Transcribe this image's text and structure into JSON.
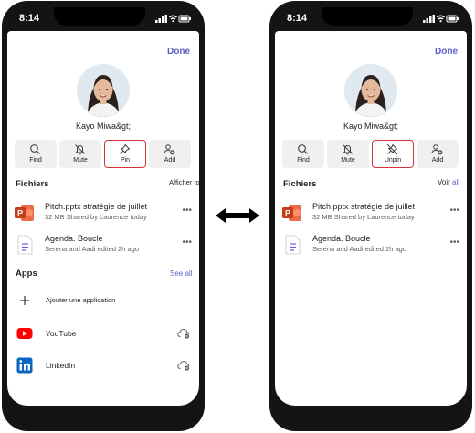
{
  "left": {
    "time": "8:14",
    "done": "Done",
    "name": "Kayo Miwa&gt;",
    "actions": [
      {
        "label": "Find",
        "icon": "search-icon"
      },
      {
        "label": "Mute",
        "icon": "bell-off-icon"
      },
      {
        "label": "Pin",
        "icon": "pin-icon"
      },
      {
        "label": "Add",
        "icon": "add-person-icon"
      }
    ],
    "files_title": "Fichiers",
    "files_link": "Afficher tout",
    "files": [
      {
        "name": "Pitch.pptx stratégie de juillet",
        "meta": "32 MB Shared by Laurence today",
        "icon": "powerpoint-icon"
      },
      {
        "name": "Agenda. Boucle",
        "meta": "Serena and Aadi edited 2h ago",
        "icon": "loop-icon"
      }
    ],
    "apps_title": "Apps",
    "apps_link": "See all",
    "add_app": "Ajouter une application",
    "apps": [
      {
        "name": "YouTube",
        "icon": "youtube-icon"
      },
      {
        "name": "LinkedIn",
        "icon": "linkedin-icon"
      }
    ]
  },
  "right": {
    "time": "8:14",
    "done": "Done",
    "name": "Kayo Miwa&gt;",
    "actions": [
      {
        "label": "Find",
        "icon": "search-icon"
      },
      {
        "label": "Mute",
        "icon": "bell-off-icon"
      },
      {
        "label": "Unpin",
        "icon": "unpin-icon"
      },
      {
        "label": "Add",
        "icon": "add-person-icon"
      }
    ],
    "files_title": "Fichiers",
    "files_link_a": "Voir ",
    "files_link_b": "all",
    "files": [
      {
        "name": "Pitch.pptx stratégie de juillet",
        "meta": "32 MB Shared by Laurence today",
        "icon": "powerpoint-icon"
      },
      {
        "name": "Agenda. Boucle",
        "meta": "Serena and Aadi edited 2h ago",
        "icon": "loop-icon"
      }
    ]
  },
  "colors": {
    "accent": "#5b5fc7",
    "highlight": "#d13438",
    "powerpoint": "#c43e1c",
    "youtube": "#ff0000",
    "linkedin": "#0a66c2",
    "loop": "#7b57e0"
  }
}
